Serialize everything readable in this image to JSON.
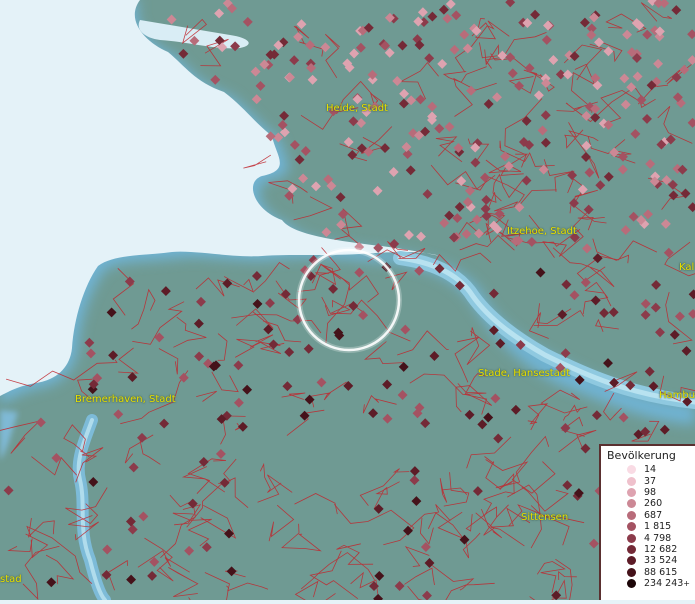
{
  "map": {
    "labels": [
      {
        "id": "heide",
        "text": "Heide, Stadt"
      },
      {
        "id": "itzehoe",
        "text": "Itzehoe, Stadt"
      },
      {
        "id": "kal",
        "text": "Kal"
      },
      {
        "id": "stade",
        "text": "Stade, Hansestadt"
      },
      {
        "id": "hambu",
        "text": "Hambu"
      },
      {
        "id": "bremerhaven",
        "text": "Bremerhaven, Stadt"
      },
      {
        "id": "sittensen",
        "text": "Sittensen"
      },
      {
        "id": "stad",
        "text": "stad"
      }
    ]
  },
  "legend": {
    "title": "Bevölkerung",
    "plus": "+",
    "entries": [
      {
        "label": "14",
        "color": "#f9dbe4"
      },
      {
        "label": "37",
        "color": "#efc1cc"
      },
      {
        "label": "98",
        "color": "#dea3b0"
      },
      {
        "label": "260",
        "color": "#cc8895"
      },
      {
        "label": "687",
        "color": "#b86c7a"
      },
      {
        "label": "1 815",
        "color": "#a45262"
      },
      {
        "label": "4 798",
        "color": "#8c3b4b"
      },
      {
        "label": "12 682",
        "color": "#742a37"
      },
      {
        "label": "33 524",
        "color": "#5d1c27"
      },
      {
        "label": "88 615",
        "color": "#45121a"
      },
      {
        "label": "234 243",
        "color": "#1c0508"
      }
    ]
  }
}
